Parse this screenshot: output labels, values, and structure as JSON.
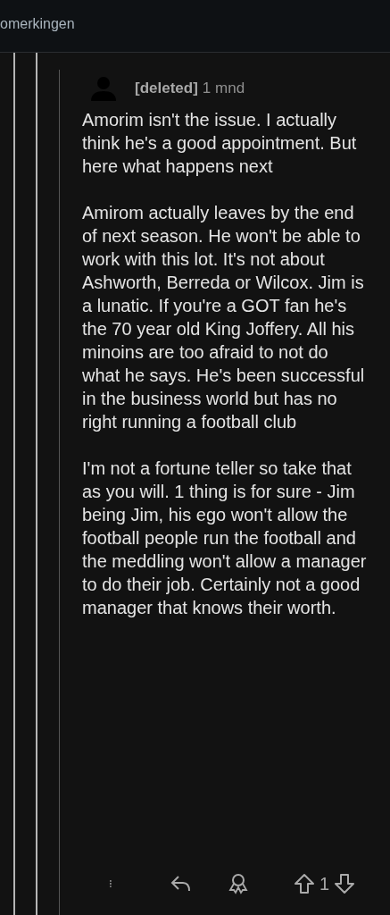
{
  "top_bar": {
    "title": "omerkingen"
  },
  "comment": {
    "author": "[deleted]",
    "age": "1 mnd",
    "paragraphs": [
      "Amorim isn't the issue. I actually think he's a good appointment. But here what happens next",
      "Amirom actually leaves by the end of next season. He won't be able to work with this lot. It's not about Ashworth, Berreda or Wilcox. Jim is a lunatic. If you're a GOT fan he's the 70 year old King Joffery. All his minoins are too afraid to not do what he says. He's been successful in the business world but has no right running a football club",
      "I'm not a fortune teller so take that as you will. 1 thing is for sure - Jim being Jim, his ego won't allow the football people run the football and the meddling won't allow a manager to do their job. Certainly not a good manager that knows their worth."
    ],
    "score": "1"
  }
}
